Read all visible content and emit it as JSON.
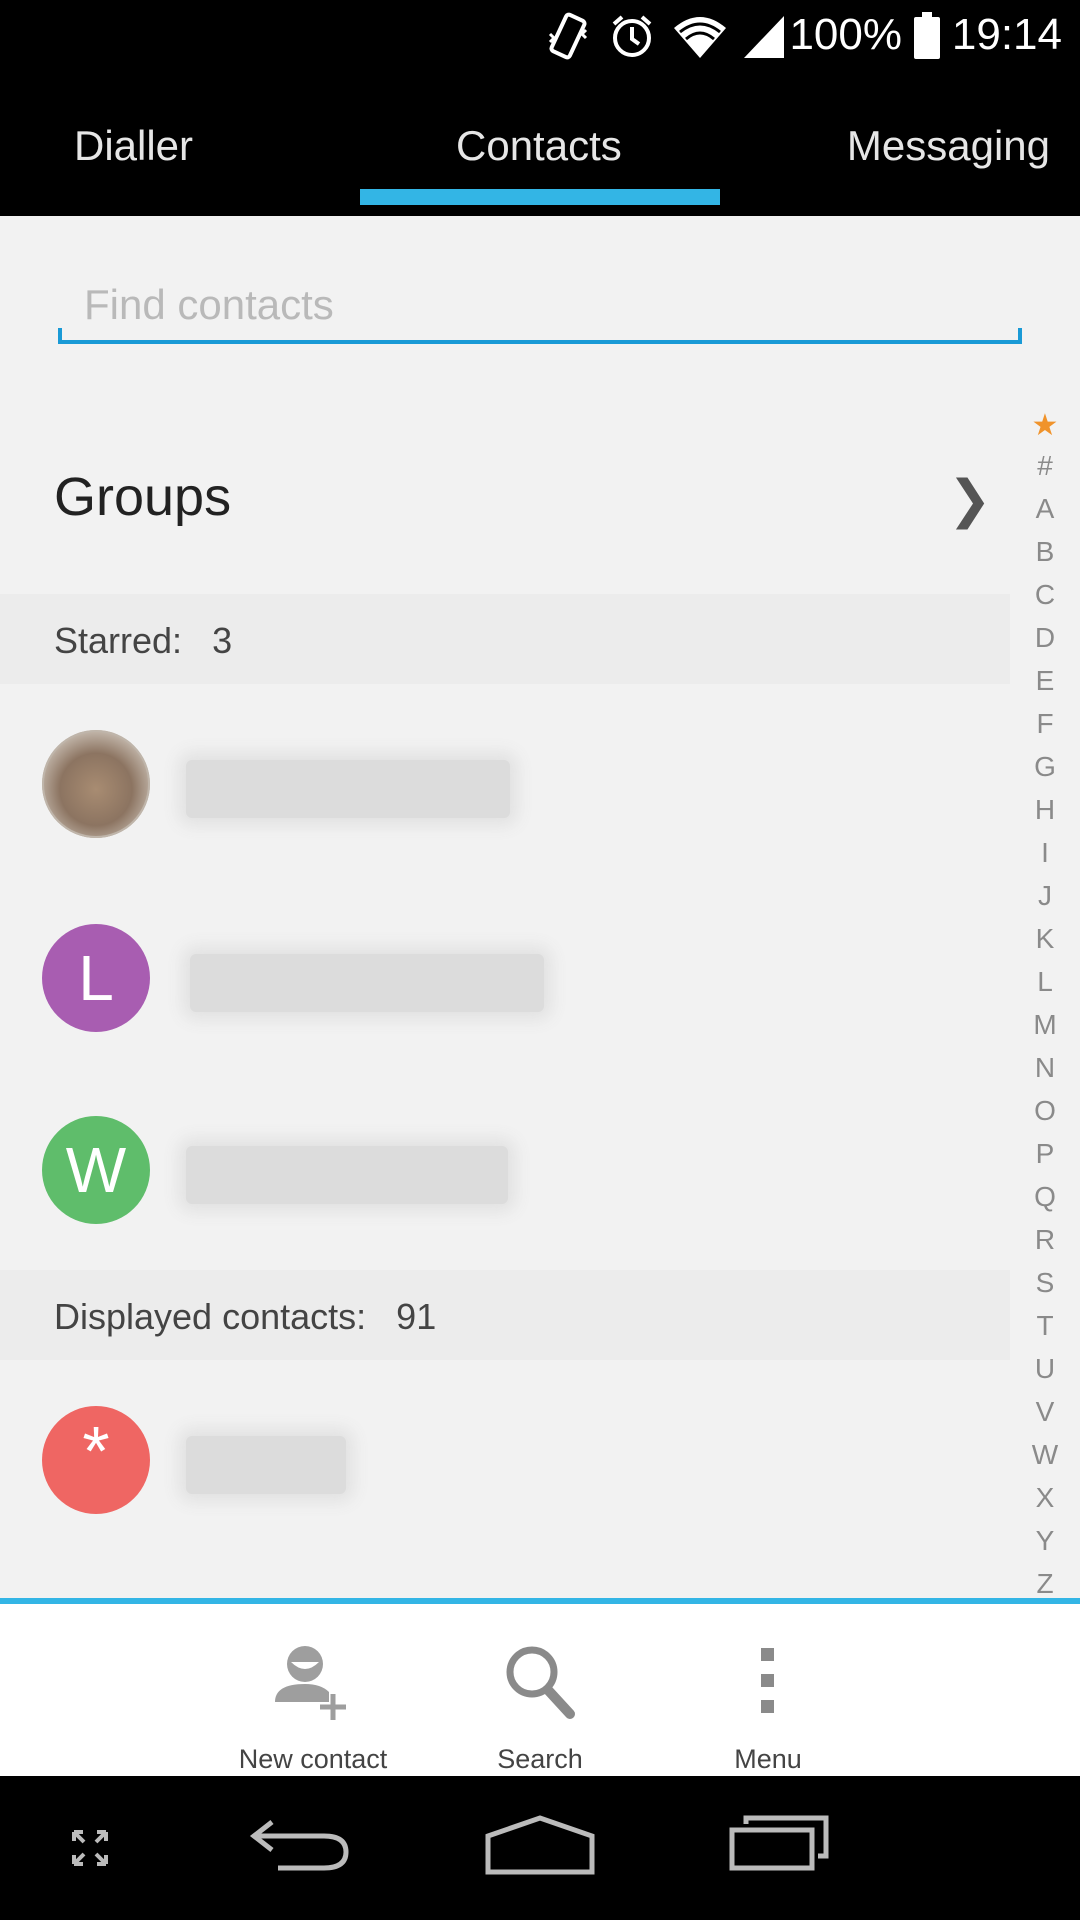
{
  "status_bar": {
    "battery_percent": "100%",
    "time": "19:14",
    "icons": [
      "vibrate-icon",
      "alarm-icon",
      "wifi-icon",
      "signal-icon",
      "battery-icon"
    ]
  },
  "tabs": [
    {
      "label": "Dialler",
      "selected": false
    },
    {
      "label": "Contacts",
      "selected": true
    },
    {
      "label": "Messaging",
      "selected": false
    }
  ],
  "accent_color": "#33b5e5",
  "search": {
    "placeholder": "Find contacts",
    "value": ""
  },
  "groups": {
    "label": "Groups",
    "chevron": "❯"
  },
  "starred": {
    "label": "Starred:",
    "count": "3",
    "contacts": [
      {
        "avatar_letter": "",
        "avatar_type": "photo",
        "avatar_color": ""
      },
      {
        "avatar_letter": "L",
        "avatar_type": "letter",
        "avatar_color": "#a85db1"
      },
      {
        "avatar_letter": "W",
        "avatar_type": "letter",
        "avatar_color": "#5fbd6b"
      }
    ]
  },
  "displayed": {
    "label": "Displayed contacts:",
    "count": "91",
    "contacts": [
      {
        "avatar_letter": "*",
        "avatar_type": "letter",
        "avatar_color": "#ef6663"
      }
    ]
  },
  "alphabet_index": [
    "#",
    "A",
    "B",
    "C",
    "D",
    "E",
    "F",
    "G",
    "H",
    "I",
    "J",
    "K",
    "L",
    "M",
    "N",
    "O",
    "P",
    "Q",
    "R",
    "S",
    "T",
    "U",
    "V",
    "W",
    "X",
    "Y",
    "Z"
  ],
  "alphabet_star": "★",
  "actions": {
    "new_contact": "New contact",
    "search": "Search",
    "menu": "Menu"
  },
  "nav": [
    "expand-icon",
    "back-icon",
    "home-icon",
    "recents-icon"
  ]
}
